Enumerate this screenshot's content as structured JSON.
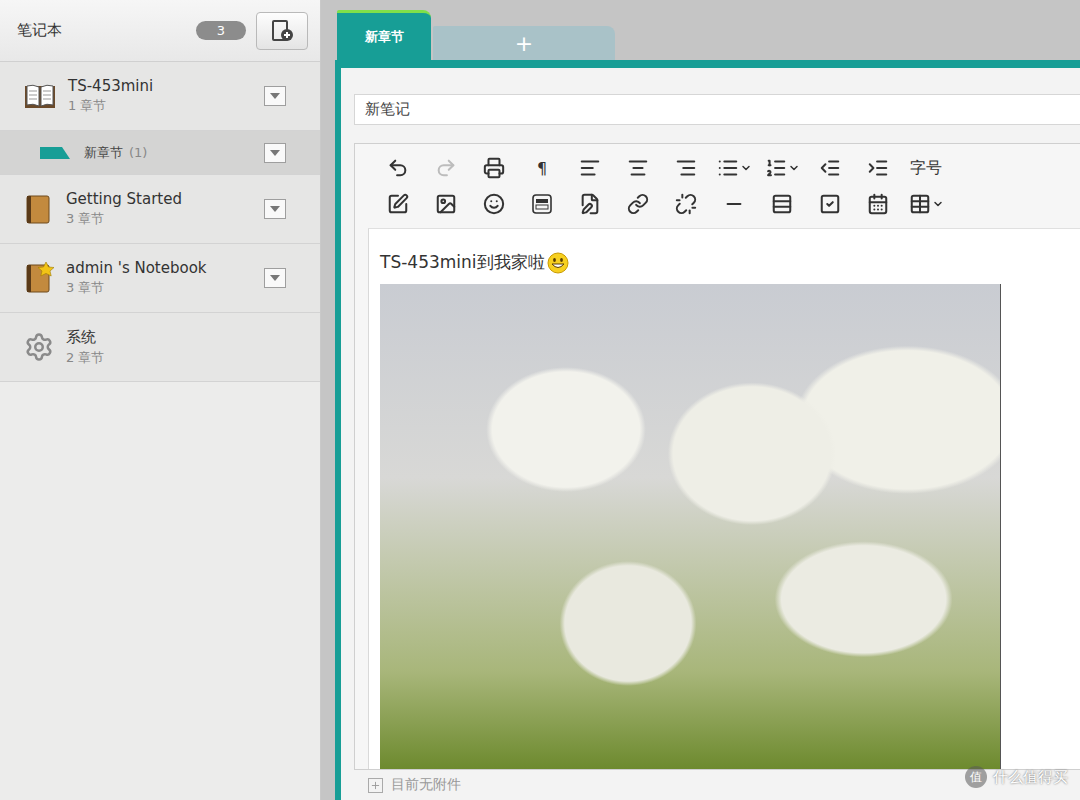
{
  "sidebar": {
    "title": "笔记本",
    "count": "3",
    "notebooks": [
      {
        "name": "TS-453mini",
        "chapters": "1 章节",
        "kind": "open-book",
        "expanded": true,
        "sections": [
          {
            "name": "新章节",
            "count": "(1)",
            "selected": true
          }
        ]
      },
      {
        "name": "Getting Started",
        "chapters": "3 章节",
        "kind": "book",
        "expanded": false,
        "sections": []
      },
      {
        "name": "admin 's Notebook",
        "chapters": "3 章节",
        "kind": "starred-book",
        "expanded": false,
        "sections": []
      },
      {
        "name": "系统",
        "chapters": "2 章节",
        "kind": "system",
        "expanded": false,
        "sections": []
      }
    ]
  },
  "tabs": [
    {
      "label": "新章节",
      "selected": true
    },
    {
      "label": "+",
      "selected": false
    }
  ],
  "note": {
    "title": "新笔记",
    "toolbar": [
      [
        {
          "kind": "undo",
          "disabled": false,
          "dropdown": false
        },
        {
          "kind": "redo",
          "disabled": true,
          "dropdown": false
        },
        {
          "kind": "print",
          "disabled": false,
          "dropdown": false
        },
        {
          "kind": "text",
          "label": "¶",
          "disabled": false,
          "dropdown": false
        },
        {
          "kind": "align-left",
          "disabled": false,
          "dropdown": false
        },
        {
          "kind": "align-center",
          "disabled": false,
          "dropdown": false
        },
        {
          "kind": "align-right",
          "disabled": false,
          "dropdown": false
        },
        {
          "kind": "bullet-list",
          "disabled": false,
          "dropdown": true
        },
        {
          "kind": "number-list",
          "disabled": false,
          "dropdown": true
        },
        {
          "kind": "outdent",
          "disabled": false,
          "dropdown": false
        },
        {
          "kind": "indent",
          "disabled": false,
          "dropdown": false
        },
        {
          "kind": "text",
          "label": "字号",
          "disabled": false,
          "dropdown": false
        }
      ],
      [
        {
          "kind": "draw",
          "disabled": false,
          "dropdown": false
        },
        {
          "kind": "image",
          "disabled": false,
          "dropdown": false
        },
        {
          "kind": "emoji",
          "disabled": false,
          "dropdown": false
        },
        {
          "kind": "video",
          "disabled": false,
          "dropdown": false
        },
        {
          "kind": "note",
          "disabled": false,
          "dropdown": false
        },
        {
          "kind": "link",
          "disabled": false,
          "dropdown": false
        },
        {
          "kind": "unlink",
          "disabled": false,
          "dropdown": false
        },
        {
          "kind": "hr",
          "disabled": false,
          "dropdown": false
        },
        {
          "kind": "rows",
          "disabled": false,
          "dropdown": false
        },
        {
          "kind": "checkbox",
          "disabled": false,
          "dropdown": false
        },
        {
          "kind": "calendar",
          "disabled": false,
          "dropdown": false
        },
        {
          "kind": "table",
          "disabled": false,
          "dropdown": true
        }
      ]
    ],
    "body": "TS-453mini到我家啦",
    "attachments": "目前无附件"
  },
  "watermark": {
    "badge": "值",
    "text": "什么值得买"
  }
}
